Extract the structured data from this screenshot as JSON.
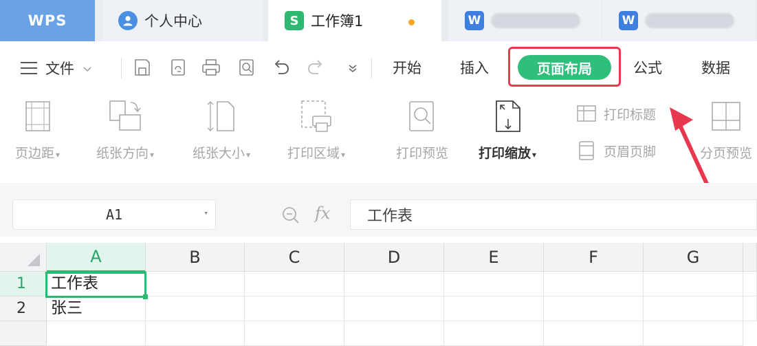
{
  "tabs": {
    "wps": "WPS",
    "personal": "个人中心",
    "workbook": "工作簿1",
    "workbook_icon": "S"
  },
  "menu": {
    "file": "文件",
    "items": [
      "开始",
      "插入",
      "页面布局",
      "公式",
      "数据"
    ],
    "active": "页面布局"
  },
  "ribbon": {
    "margins": "页边距",
    "orientation": "纸张方向",
    "size": "纸张大小",
    "print_area": "打印区域",
    "print_preview": "打印预览",
    "print_scale": "打印缩放",
    "print_titles": "打印标题",
    "header_footer": "页眉页脚",
    "page_break_preview": "分页预览"
  },
  "formula_bar": {
    "name_box": "A1",
    "fx": "fx",
    "value": "工作表"
  },
  "grid": {
    "columns": [
      "A",
      "B",
      "C",
      "D",
      "E",
      "F",
      "G"
    ],
    "rows": [
      {
        "num": "1",
        "a": "工作表"
      },
      {
        "num": "2",
        "a": "张三"
      }
    ]
  },
  "colors": {
    "accent_green": "#2ec07b",
    "highlight_red": "#e8384f",
    "wps_blue": "#6aa2e6"
  }
}
